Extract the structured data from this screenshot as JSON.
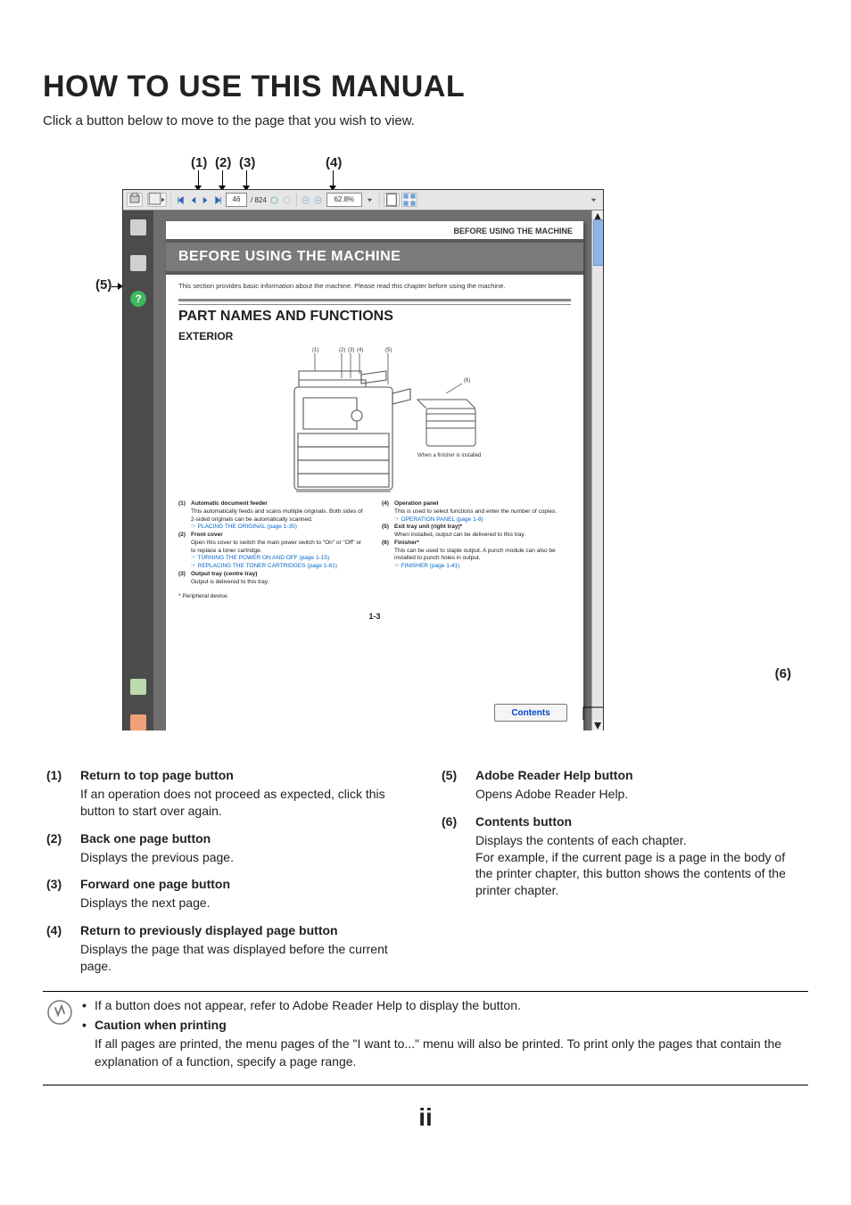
{
  "title": "HOW TO USE THIS MANUAL",
  "intro": "Click a button below to move to the page that you wish to view.",
  "roman": "ii",
  "callouts": {
    "c1": "(1)",
    "c2": "(2)",
    "c3": "(3)",
    "c4": "(4)",
    "c5": "(5)",
    "c6": "(6)"
  },
  "toolbar": {
    "page_current": "46",
    "page_total": "/ 824",
    "zoom": "62.8%"
  },
  "sidebar_help_glyph": "?",
  "inner": {
    "running_head": "BEFORE USING THE MACHINE",
    "band": "BEFORE USING THE MACHINE",
    "sub": "This section provides basic information about the machine. Please read this chapter before using the machine.",
    "h2": "PART NAMES AND FUNCTIONS",
    "h3": "EXTERIOR",
    "page_num": "1-3",
    "contents_btn": "Contents",
    "finisher_caption": "When a finisher is installed",
    "peripheral": "* Peripheral device.",
    "labels": {
      "l1": "(1)",
      "l2": "(2)",
      "l3": "(3)",
      "l4": "(4)",
      "l5": "(5)",
      "l6": "(6)"
    },
    "parts_left": [
      {
        "num": "(1)",
        "name": "Automatic document feeder",
        "desc": "This automatically feeds and scans multiple originals. Both sides of 2-sided originals can be automatically scanned.",
        "link": "☞ PLACING THE ORIGINAL (page 1-35)"
      },
      {
        "num": "(2)",
        "name": "Front cover",
        "desc": "Open this cover to switch the main power switch to \"On\" or \"Off\" or to replace a toner cartridge.",
        "link": "☞ TURNING THE POWER ON AND OFF (page 1-15)",
        "link2": "☞ REPLACING THE TONER CARTRIDGES (page 1-61)"
      },
      {
        "num": "(3)",
        "name": "Output tray (centre tray)",
        "desc": "Output is delivered to this tray.",
        "link": ""
      }
    ],
    "parts_right": [
      {
        "num": "(4)",
        "name": "Operation panel",
        "desc": "This is used to select functions and enter the number of copies.",
        "link": "☞ OPERATION PANEL (page 1-8)"
      },
      {
        "num": "(5)",
        "name": "Exit tray unit (right tray)*",
        "desc": "When installed, output can be delivered to this tray.",
        "link": ""
      },
      {
        "num": "(6)",
        "name": "Finisher*",
        "desc": "This can be used to staple output. A punch module can also be installed to punch holes in output.",
        "link": "☞ FINISHER (page 1-41)"
      }
    ]
  },
  "definitions_left": [
    {
      "num": "(1)",
      "head": "Return to top page button",
      "body": "If an operation does not proceed as expected, click this button to start over again."
    },
    {
      "num": "(2)",
      "head": "Back one page button",
      "body": "Displays the previous page."
    },
    {
      "num": "(3)",
      "head": "Forward one page button",
      "body": "Displays the next page."
    },
    {
      "num": "(4)",
      "head": "Return to previously displayed page button",
      "body": "Displays the page that was displayed before the current page."
    }
  ],
  "definitions_right": [
    {
      "num": "(5)",
      "head": "Adobe Reader Help button",
      "body": "Opens Adobe Reader Help."
    },
    {
      "num": "(6)",
      "head": "Contents button",
      "body": "Displays the contents of each chapter.\nFor example, if the current page is a page in the body of the printer chapter, this button shows the contents of the printer chapter."
    }
  ],
  "notes": {
    "line1": "If a button does not appear, refer to Adobe Reader Help to display the button.",
    "caution_head": "Caution when printing",
    "caution_body": "If all pages are printed, the menu pages of the \"I want to...\" menu will also be printed. To print only the pages that contain the explanation of a function, specify a page range."
  }
}
